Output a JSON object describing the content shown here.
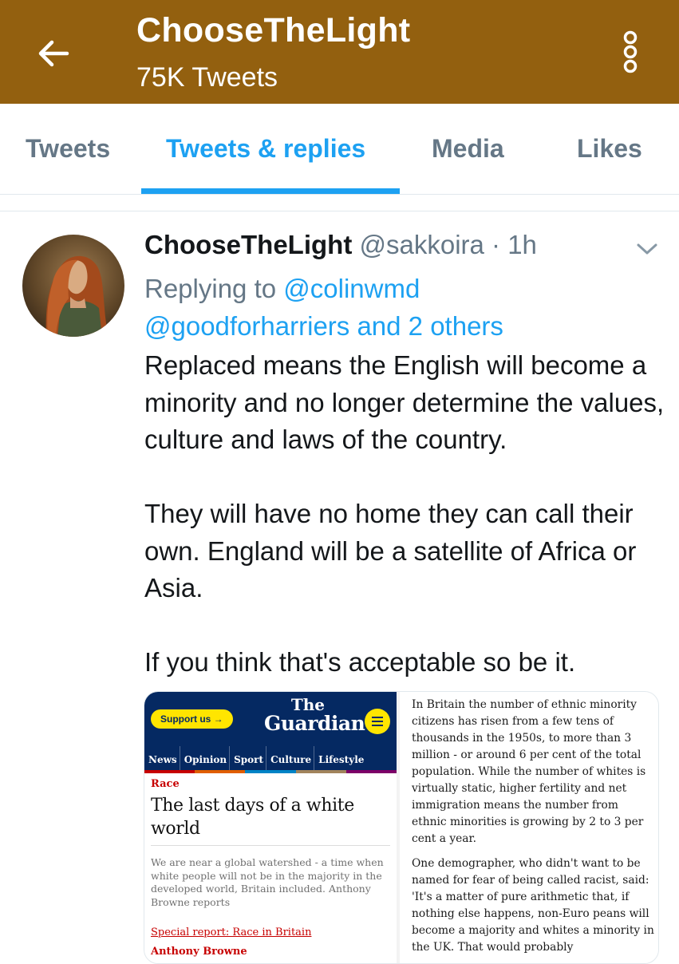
{
  "header": {
    "title": "ChooseTheLight",
    "tweet_count": "75K Tweets"
  },
  "tabs": [
    {
      "label": "Tweets",
      "active": false
    },
    {
      "label": "Tweets & replies",
      "active": true
    },
    {
      "label": "Media",
      "active": false
    },
    {
      "label": "Likes",
      "active": false
    }
  ],
  "tweet": {
    "display_name": "ChooseTheLight",
    "handle": "@sakkoira",
    "separator": " · ",
    "time": "1h",
    "replying_prefix": "Replying to ",
    "reply_user_1": "@colinwmd",
    "reply_user_2": "@goodforharriers",
    "reply_others": " and 2 others",
    "text": "Replaced means the English will become a minority and no longer determine the values, culture and laws of the country.\n\nThey will have no home they can call their own. England will be a satellite of Africa or Asia.\n\nIf you think that's acceptable so be it."
  },
  "media": {
    "support_label": "Support us →",
    "logo_the": "The",
    "logo_guardian": "Guardian",
    "nav": [
      "News",
      "Opinion",
      "Sport",
      "Culture",
      "Lifestyle"
    ],
    "nav_stripe_colors": [
      "#c70000",
      "#e05e00",
      "#0084c6",
      "#a1845c",
      "#7d0068"
    ],
    "kicker": "Race",
    "headline": "The last days of a white world",
    "standfirst": "We are near a global watershed - a time when white people will not be in the majority in the developed world, Britain included. Anthony Browne reports",
    "series_link": "Special report: Race in Britain",
    "author": "Anthony Browne",
    "right_paragraph_1": "In Britain the number of ethnic minority citizens has risen from a few tens of thousands in the 1950s, to more than 3 million - or around 6 per cent of the total population. While the number of whites is virtually static, higher fertility and net immigration means the number from ethnic minorities is growing by 2 to 3 per cent a year.",
    "right_paragraph_2": "One demographer, who didn't want to be named for fear of being called racist, said: 'It's a matter of pure arithmetic that, if nothing else happens, non-Euro peans will become a majority and whites a minority in the UK. That would probably"
  },
  "colors": {
    "header_bg": "#93600f",
    "accent": "#1da1f2",
    "muted": "#657786",
    "guardian_blue": "#052962",
    "guardian_yellow": "#ffe500"
  }
}
